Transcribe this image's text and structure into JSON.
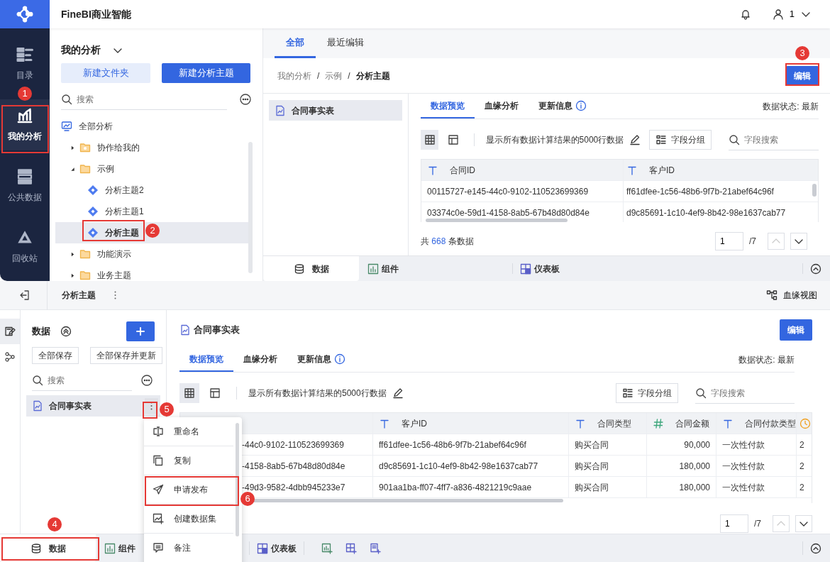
{
  "top": {
    "app_title": "FineBI商业智能",
    "user": "1",
    "rail": [
      {
        "label": "目录",
        "selected": false
      },
      {
        "label": "我的分析",
        "selected": true
      },
      {
        "label": "公共数据",
        "selected": false
      },
      {
        "label": "回收站",
        "selected": false
      }
    ],
    "panel_title": "我的分析",
    "new_folder": "新建文件夹",
    "new_subject": "新建分析主题",
    "search": {
      "placeholder": "搜索"
    },
    "tree": [
      {
        "label": "全部分析",
        "kind": "root",
        "children": [
          {
            "label": "协作给我的",
            "kind": "shared",
            "expanded": false
          },
          {
            "label": "示例",
            "kind": "folder",
            "expanded": true,
            "children": [
              {
                "label": "分析主题2",
                "kind": "subject",
                "selected": false
              },
              {
                "label": "分析主题1",
                "kind": "subject",
                "selected": false
              },
              {
                "label": "分析主题",
                "kind": "subject",
                "selected": true
              }
            ]
          },
          {
            "label": "功能演示",
            "kind": "folder",
            "expanded": false
          },
          {
            "label": "业务主题",
            "kind": "folder",
            "expanded": false
          }
        ]
      }
    ],
    "view_tabs": [
      {
        "label": "全部",
        "selected": true
      },
      {
        "label": "最近编辑",
        "selected": false
      }
    ],
    "breadcrumb": {
      "items": [
        "我的分析",
        "示例",
        "分析主题"
      ],
      "separator": "/"
    },
    "edit": "编辑",
    "tables": [
      {
        "label": "合同事实表",
        "selected": true
      }
    ],
    "preview": {
      "tabs": [
        {
          "label": "数据预览",
          "selected": true,
          "info": false
        },
        {
          "label": "血缘分析",
          "selected": false,
          "info": false
        },
        {
          "label": "更新信息",
          "selected": false,
          "info": true
        }
      ],
      "status": "数据状态: 最新",
      "hint": "显示所有数据计算结果的5000行数据",
      "group": "字段分组",
      "field_search": {
        "placeholder": "字段搜索"
      },
      "columns": [
        {
          "label": "合同ID",
          "kind": "text"
        },
        {
          "label": "客户ID",
          "kind": "text"
        }
      ],
      "rows": [
        [
          "00115727-e145-44c0-9102-110523699369",
          "ff61dfee-1c56-48b6-9f7b-21abef64c96f"
        ],
        [
          "03374c0e-59d1-4158-8ab5-67b48d80d84e",
          "d9c85691-1c10-4ef9-8b42-98e1637cab77"
        ]
      ],
      "total": {
        "prefix": "共",
        "count": "668",
        "suffix": "条数据"
      },
      "page": "1",
      "pages": "/7"
    },
    "dock": [
      {
        "label": "数据",
        "selected": true
      },
      {
        "label": "组件",
        "selected": false
      },
      {
        "label": "仪表板",
        "selected": false
      }
    ]
  },
  "bottom": {
    "title": "分析主题",
    "lineage": "血缘视图",
    "side": [
      {
        "selected": true
      },
      {
        "selected": false
      }
    ],
    "panel_title": "数据",
    "save_all": "全部保存",
    "save_update": "全部保存并更新",
    "search": {
      "placeholder": "搜索"
    },
    "tables": [
      {
        "label": "合同事实表",
        "selected": true
      }
    ],
    "menu": [
      {
        "label": "重命名"
      },
      {
        "label": "复制"
      },
      {
        "label": "申请发布"
      },
      {
        "label": "创建数据集"
      },
      {
        "label": "备注"
      }
    ],
    "table_title": "合同事实表",
    "edit": "编辑",
    "preview": {
      "tabs": [
        {
          "label": "数据预览",
          "selected": true,
          "info": false
        },
        {
          "label": "血缘分析",
          "selected": false,
          "info": false
        },
        {
          "label": "更新信息",
          "selected": false,
          "info": true
        }
      ],
      "status": "数据状态: 最新",
      "hint": "显示所有数据计算结果的5000行数据",
      "group": "字段分组",
      "field_search": {
        "placeholder": "字段搜索"
      },
      "columns": [
        {},
        {
          "label": "客户ID",
          "kind": "text"
        },
        {
          "label": "合同类型",
          "kind": "text"
        },
        {
          "label": "合同金额",
          "kind": "number"
        },
        {
          "label": "合同付款类型",
          "kind": "text"
        },
        {
          "kind": "date"
        }
      ],
      "rows": [
        [
          "-44c0-9102-110523699369",
          "ff61dfee-1c56-48b6-9f7b-21abef64c96f",
          "购买合同",
          "90,000",
          "一次性付款",
          "2"
        ],
        [
          "-4158-8ab5-67b48d80d84e",
          "d9c85691-1c10-4ef9-8b42-98e1637cab77",
          "购买合同",
          "180,000",
          "一次性付款",
          "2"
        ],
        [
          "-49d3-9582-4dbb945233e7",
          "901aa1ba-ff07-4ff7-a836-4821219c9aae",
          "购买合同",
          "180,000",
          "一次性付款",
          "2"
        ]
      ],
      "page": "1",
      "pages": "/7"
    },
    "dock": [
      {
        "label": "数据",
        "selected": true
      },
      {
        "label": "组件",
        "selected": false
      },
      {
        "label": "仪表板",
        "selected": false
      }
    ]
  },
  "callouts": [
    "1",
    "2",
    "3",
    "4",
    "5",
    "6"
  ]
}
